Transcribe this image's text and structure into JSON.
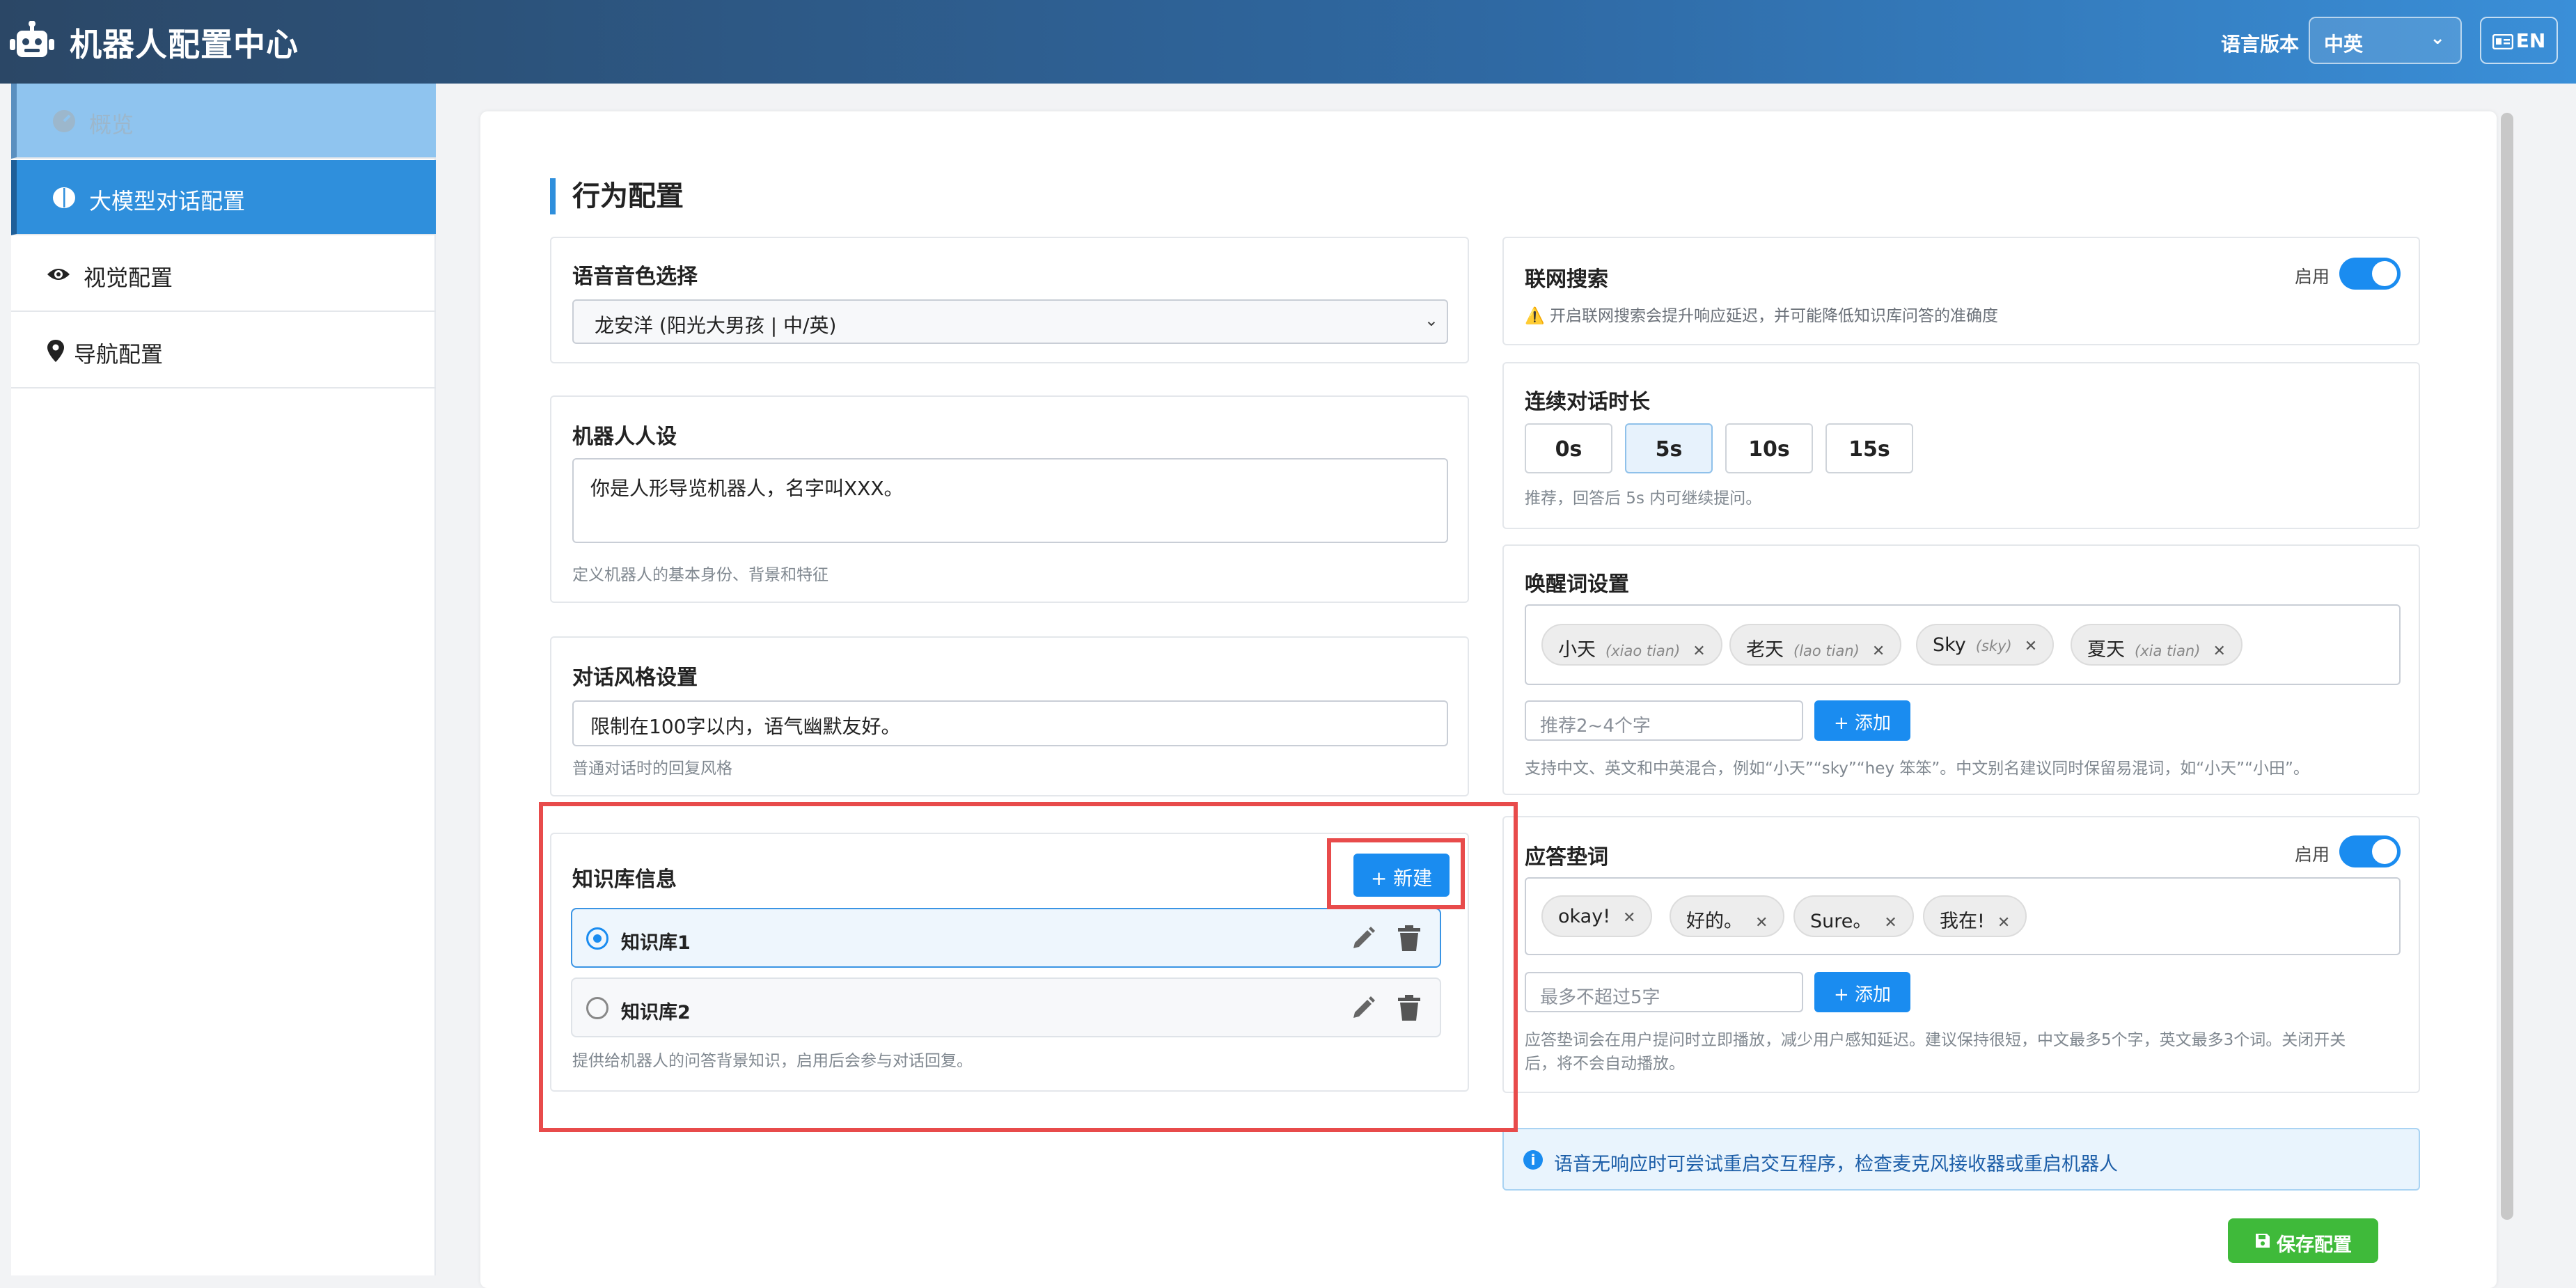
{
  "app": {
    "title": "机器人配置中心"
  },
  "header": {
    "lang_label": "语言版本",
    "lang_value": "中英",
    "en_button": "EN"
  },
  "sidebar": {
    "items": [
      {
        "label": "概览",
        "icon": "gauge-icon"
      },
      {
        "label": "大模型对话配置",
        "icon": "brain-icon"
      },
      {
        "label": "视觉配置",
        "icon": "eye-icon"
      },
      {
        "label": "导航配置",
        "icon": "map-pin-icon"
      }
    ]
  },
  "main": {
    "section_title": "行为配置",
    "voice": {
      "title": "语音音色选择",
      "value": "龙安洋 (阳光大男孩 | 中/英)"
    },
    "persona": {
      "title": "机器人人设",
      "value": "你是人形导览机器人，名字叫XXX。",
      "hint": "定义机器人的基本身份、背景和特征"
    },
    "style": {
      "title": "对话风格设置",
      "value": "限制在100字以内，语气幽默友好。",
      "hint": "普通对话时的回复风格"
    },
    "kb": {
      "title": "知识库信息",
      "new_button": "+ 新建",
      "items": [
        {
          "name": "知识库1",
          "selected": true
        },
        {
          "name": "知识库2",
          "selected": false
        }
      ],
      "hint": "提供给机器人的问答背景知识，启用后会参与对话回复。"
    },
    "web_search": {
      "title": "联网搜索",
      "toggle_label": "启用",
      "enabled": true,
      "hint": "⚠️ 开启联网搜索会提升响应延迟，并可能降低知识库问答的准确度"
    },
    "duration": {
      "title": "连续对话时长",
      "options": [
        "0s",
        "5s",
        "10s",
        "15s"
      ],
      "selected": "5s",
      "hint": "推荐，回答后 5s 内可继续提问。"
    },
    "wake": {
      "title": "唤醒词设置",
      "tags": [
        {
          "text": "小天",
          "pinyin": "(xiao tian)"
        },
        {
          "text": "老天",
          "pinyin": "(lao tian)"
        },
        {
          "text": "Sky",
          "pinyin": "(sky)"
        },
        {
          "text": "夏天",
          "pinyin": "(xia tian)"
        }
      ],
      "placeholder": "推荐2~4个字",
      "add_button": "+ 添加",
      "hint": "支持中文、英文和中英混合，例如“小天”“sky”“hey 笨笨”。中文别名建议同时保留易混词，如“小天”“小田”。"
    },
    "filler": {
      "title": "应答垫词",
      "toggle_label": "启用",
      "enabled": true,
      "tags": [
        "okay!",
        "好的。",
        "Sure。",
        "我在!"
      ],
      "placeholder": "最多不超过5字",
      "add_button": "+ 添加",
      "hint_line1": "应答垫词会在用户提问时立即播放，减少用户感知延迟。建议保持很短，中文最多5个字，英文最多3个词。关闭开关",
      "hint_line2": "后，将不会自动播放。"
    },
    "info": "语音无响应时可尝试重启交互程序，检查麦克风接收器或重启机器人",
    "save_button": "保存配置"
  }
}
